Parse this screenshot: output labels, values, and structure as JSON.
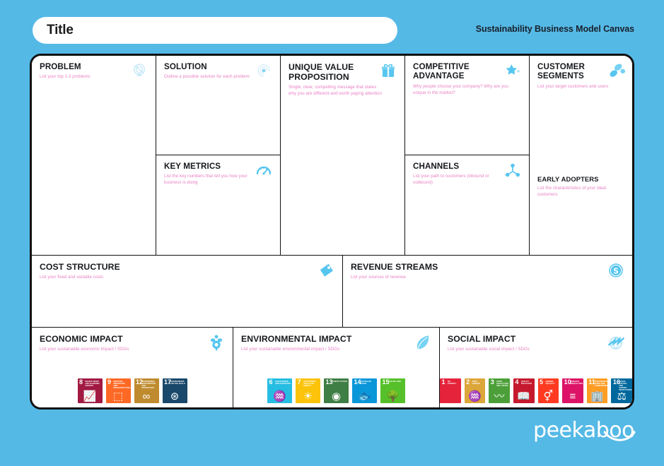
{
  "header": {
    "title": "Title",
    "title_placeholder": "Title",
    "subtitle": "Sustainability Business Model Canvas"
  },
  "footer": {
    "logo_text": "peekaboo"
  },
  "colors": {
    "background": "#55b9e6",
    "card": "#ffffff",
    "border": "#111111",
    "subtitle_pink": "#e87ec2",
    "heading": "#16181c",
    "icon_blue": "#4ec3ef"
  },
  "cells": {
    "problem": {
      "title": "PROBLEM",
      "subtitle": "List your top 1-3 problems",
      "icon": "lightbulb-problem-icon"
    },
    "solution": {
      "title": "SOLUTION",
      "subtitle": "Outline a possible solution for each problem",
      "icon": "spiral-solution-icon"
    },
    "uvp": {
      "title": "UNIQUE VALUE PROPOSITION",
      "subtitle": "Single, clear, compelling message that states why you are different and worth paying attention",
      "icon": "gift-value-icon"
    },
    "competitive": {
      "title": "COMPETITIVE ADVANTAGE",
      "subtitle": "Why people choose your company? Why are you unique in the market?",
      "icon": "star-advantage-icon"
    },
    "customer": {
      "title": "CUSTOMER SEGMENTS",
      "subtitle": "List your target customers and users",
      "icon": "people-segments-icon"
    },
    "key_metrics": {
      "title": "KEY METRICS",
      "subtitle": "List the key numbers that tell you how your business is doing",
      "icon": "gauge-metrics-icon"
    },
    "channels": {
      "title": "CHANNELS",
      "subtitle": "List your path to customers (inbound or outbound)",
      "icon": "network-channels-icon"
    },
    "early_adopters": {
      "title": "EARLY ADOPTERS",
      "subtitle": "List the characteristics of your ideal customers"
    },
    "cost": {
      "title": "COST STRUCTURE",
      "subtitle": "List your fixed and variable costs",
      "icon": "price-tag-cost-icon"
    },
    "revenue": {
      "title": "REVENUE STREAMS",
      "subtitle": "List your sources of revenue",
      "icon": "dollar-coin-revenue-icon"
    },
    "economic": {
      "title": "ECONOMIC IMPACT",
      "subtitle": "List your sustainable economic impact / SDGs",
      "icon": "economic-growth-icon"
    },
    "environmental": {
      "title": "ENVIRONMENTAL  IMPACT",
      "subtitle": "List your sustainable environmental impact / SDGs",
      "icon": "leaf-environment-icon"
    },
    "social": {
      "title": "SOCIAL IMPACT",
      "subtitle": "List your sustainable social impact / SDGs",
      "icon": "globe-social-icon"
    }
  },
  "sdg": {
    "economic": [
      {
        "num": "8",
        "label": "DECENT WORK AND ECONOMIC GROWTH",
        "color": "#A21942",
        "glyph": "📈"
      },
      {
        "num": "9",
        "label": "INDUSTRY, INNOVATION AND INFRASTRUCTURE",
        "color": "#FD6925",
        "glyph": "⬚"
      },
      {
        "num": "12",
        "label": "RESPONSIBLE CONSUMPTION AND PRODUCTION",
        "color": "#BF8B2E",
        "glyph": "∞"
      },
      {
        "num": "17",
        "label": "PARTNERSHIPS FOR THE GOALS",
        "color": "#19486A",
        "glyph": "⊛"
      }
    ],
    "environmental": [
      {
        "num": "6",
        "label": "CLEAN WATER AND SANITATION",
        "color": "#26BDE2",
        "glyph": "♒"
      },
      {
        "num": "7",
        "label": "AFFORDABLE AND CLEAN ENERGY",
        "color": "#FCC30B",
        "glyph": "☀"
      },
      {
        "num": "13",
        "label": "CLIMATE ACTION",
        "color": "#3F7E44",
        "glyph": "◉"
      },
      {
        "num": "14",
        "label": "LIFE BELOW WATER",
        "color": "#0A97D9",
        "glyph": "🐟"
      },
      {
        "num": "15",
        "label": "LIFE ON LAND",
        "color": "#56C02B",
        "glyph": "🌳"
      }
    ],
    "social": [
      {
        "num": "1",
        "label": "NO POVERTY",
        "color": "#E5243B",
        "glyph": " "
      },
      {
        "num": "2",
        "label": "ZERO HUNGER",
        "color": "#DDA63A",
        "glyph": "♒"
      },
      {
        "num": "3",
        "label": "GOOD HEALTH AND WELL-BEING",
        "color": "#4C9F38",
        "glyph": "〰"
      },
      {
        "num": "4",
        "label": "QUALITY EDUCATION",
        "color": "#C5192D",
        "glyph": "📖"
      },
      {
        "num": "5",
        "label": "GENDER EQUALITY",
        "color": "#FF3A21",
        "glyph": "⚥"
      },
      {
        "num": "10",
        "label": "REDUCED INEQUALITIES",
        "color": "#DD1367",
        "glyph": "≡"
      },
      {
        "num": "11",
        "label": "SUSTAINABLE CITIES AND COMMUNITIES",
        "color": "#FD9D24",
        "glyph": "🏢"
      },
      {
        "num": "16",
        "label": "PEACE, JUSTICE AND STRONG INSTITUTIONS",
        "color": "#00689D",
        "glyph": "⚖"
      }
    ]
  }
}
